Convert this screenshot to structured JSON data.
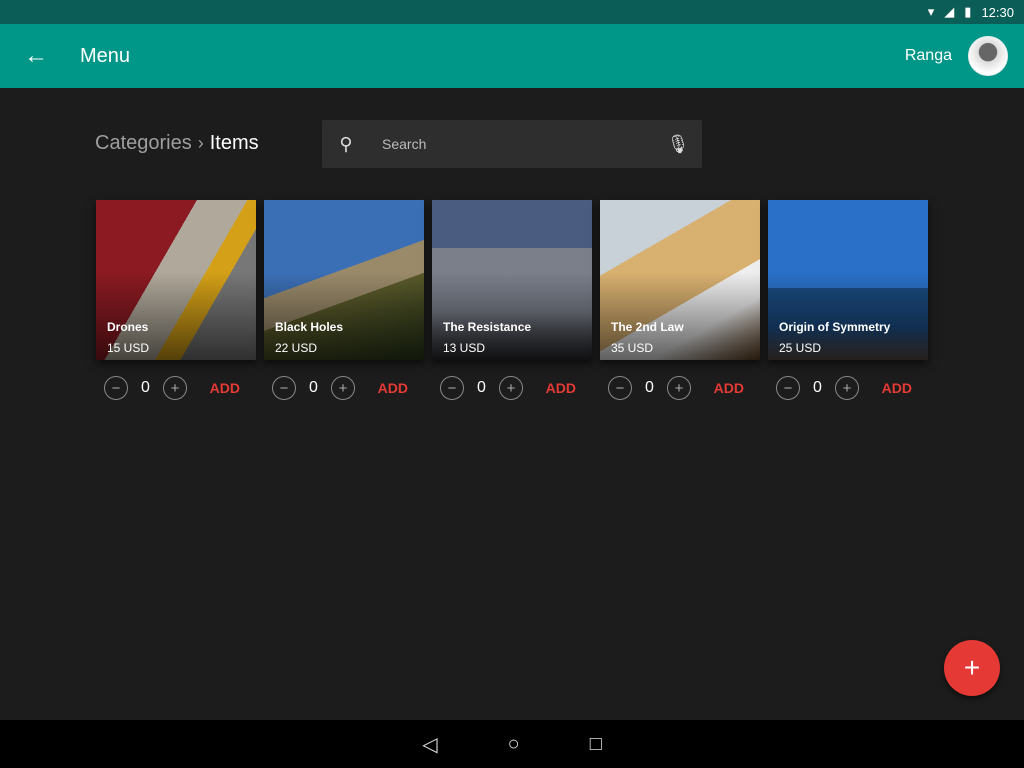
{
  "status": {
    "time": "12:30",
    "icons": [
      "wifi-icon",
      "signal-icon",
      "battery-icon"
    ]
  },
  "appbar": {
    "title": "Menu",
    "user": "Ranga",
    "back_icon": "arrow-left-icon"
  },
  "breadcrumb": {
    "parent": "Categories",
    "current": "Items"
  },
  "search": {
    "placeholder": "Search"
  },
  "items": [
    {
      "name": "Drones",
      "price": "15 USD",
      "qty": "0"
    },
    {
      "name": "Black Holes",
      "price": "22 USD",
      "qty": "0"
    },
    {
      "name": "The Resistance",
      "price": "13 USD",
      "qty": "0"
    },
    {
      "name": "The 2nd Law",
      "price": "35 USD",
      "qty": "0"
    },
    {
      "name": "Origin of Symmetry",
      "price": "25 USD",
      "qty": "0"
    }
  ],
  "add_label": "ADD",
  "colors": {
    "primary": "#009688",
    "status": "#0b5e57",
    "accent": "#e53935",
    "background": "#1c1c1c"
  }
}
